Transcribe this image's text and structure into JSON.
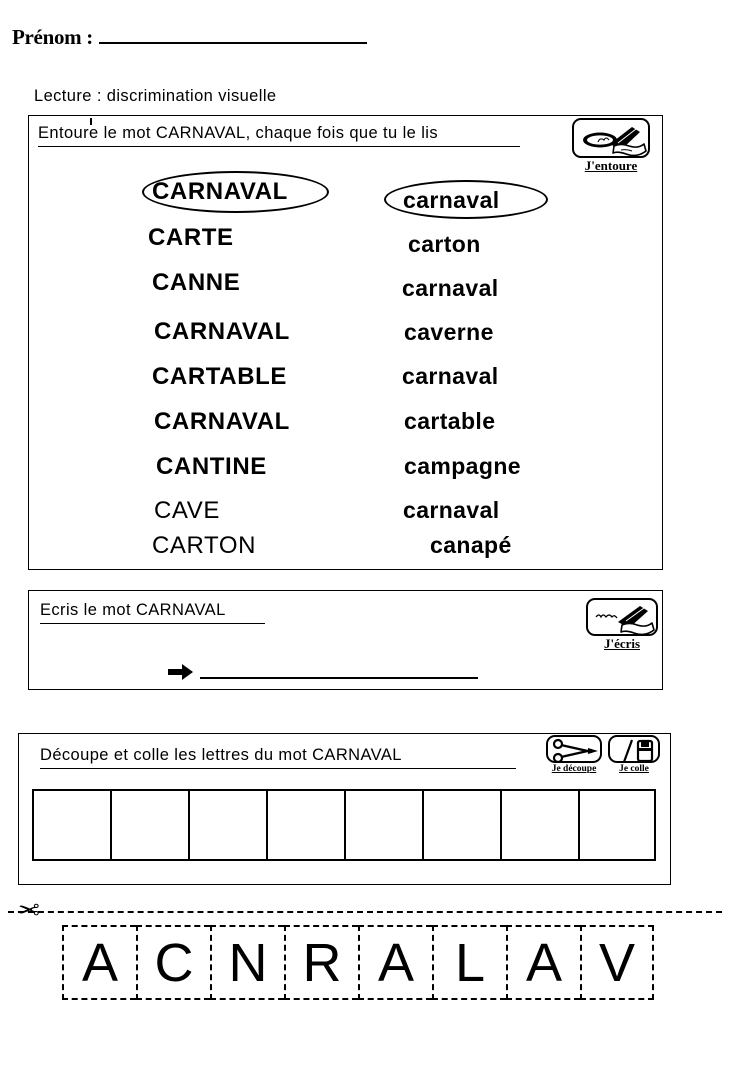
{
  "page": {
    "title": "Lecture : discrimination visuelle — CARNAVAL",
    "target_word": "CARNAVAL",
    "ink_color": "#000000",
    "paper_color": "#ffffff"
  },
  "name_field": {
    "label": "Prénom :",
    "value": "",
    "placeholder": ""
  },
  "section_caption": {
    "text": "Lecture : discrimination visuelle"
  },
  "exercise_circle": {
    "instruction": "Entoure le mot CARNAVAL, chaque fois que tu le lis",
    "picto": {
      "caption": "J'entoure",
      "icon": "hand-circling-word-icon"
    },
    "left_column": [
      {
        "text": "CARNAVAL",
        "circled": true,
        "match": true
      },
      {
        "text": "CARTE",
        "circled": false,
        "match": false
      },
      {
        "text": "CANNE",
        "circled": false,
        "match": false
      },
      {
        "text": "CARNAVAL",
        "circled": false,
        "match": true
      },
      {
        "text": "CARTABLE",
        "circled": false,
        "match": false
      },
      {
        "text": "CARNAVAL",
        "circled": false,
        "match": true
      },
      {
        "text": "CANTINE",
        "circled": false,
        "match": false
      },
      {
        "text": "CAVE",
        "circled": false,
        "match": false
      },
      {
        "text": "CARTON",
        "circled": false,
        "match": false
      }
    ],
    "right_column": [
      {
        "text": "carnaval",
        "circled": true,
        "match": true
      },
      {
        "text": "carton",
        "circled": false,
        "match": false
      },
      {
        "text": "carnaval",
        "circled": false,
        "match": true
      },
      {
        "text": "caverne",
        "circled": false,
        "match": false
      },
      {
        "text": "carnaval",
        "circled": false,
        "match": true
      },
      {
        "text": "cartable",
        "circled": false,
        "match": false
      },
      {
        "text": "campagne",
        "circled": false,
        "match": false
      },
      {
        "text": "carnaval",
        "circled": false,
        "match": true
      },
      {
        "text": "canapé",
        "circled": false,
        "match": false
      }
    ]
  },
  "exercise_write": {
    "instruction": "Ecris le mot CARNAVAL",
    "picto": {
      "caption": "J'écris",
      "icon": "hand-writing-icon"
    },
    "answer_value": ""
  },
  "exercise_cutpaste": {
    "instruction": "Découpe et colle les lettres du mot CARNAVAL",
    "pictos": [
      {
        "caption": "Je découpe",
        "icon": "scissors-icon"
      },
      {
        "caption": "Je colle",
        "icon": "glue-stick-icon"
      }
    ],
    "cells": [
      "",
      "",
      "",
      "",
      "",
      "",
      "",
      ""
    ],
    "cell_count": 8
  },
  "cut_strip": {
    "cut_icon": "scissors-icon",
    "letters": [
      "A",
      "C",
      "N",
      "R",
      "A",
      "L",
      "A",
      "V"
    ]
  }
}
